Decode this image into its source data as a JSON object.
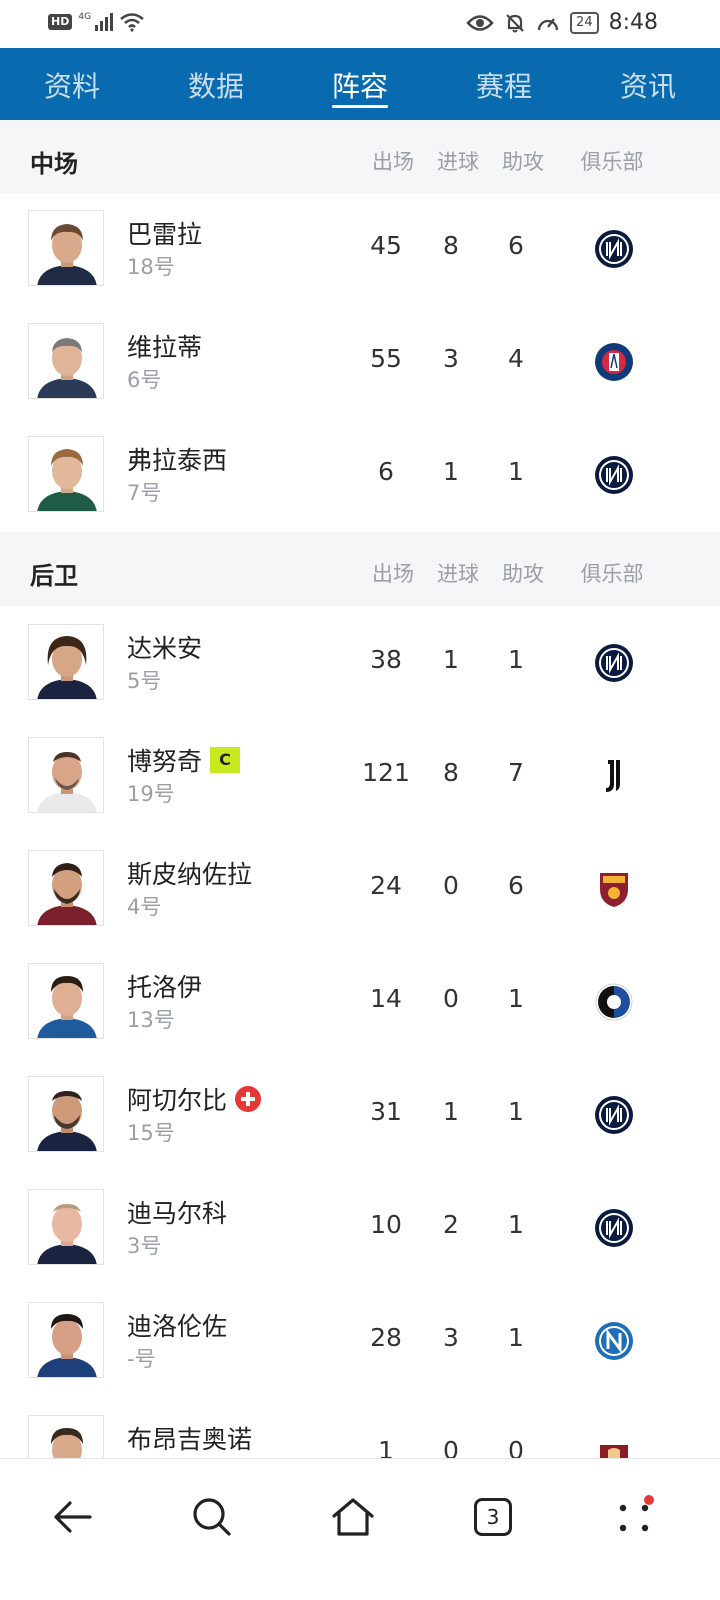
{
  "status_bar": {
    "hd": "HD",
    "network": "4G",
    "battery": "24",
    "time": "8:48"
  },
  "tabs": [
    {
      "label": "资料",
      "active": false
    },
    {
      "label": "数据",
      "active": false
    },
    {
      "label": "阵容",
      "active": true
    },
    {
      "label": "赛程",
      "active": false
    },
    {
      "label": "资讯",
      "active": false
    }
  ],
  "sections": [
    {
      "title": "中场",
      "columns": [
        "出场",
        "进球",
        "助攻",
        "俱乐部"
      ],
      "players": [
        {
          "name": "巴雷拉",
          "number": "18号",
          "apps": "45",
          "goals": "8",
          "assists": "6",
          "club_icon": "inter-logo"
        },
        {
          "name": "维拉蒂",
          "number": "6号",
          "apps": "55",
          "goals": "3",
          "assists": "4",
          "club_icon": "psg-logo"
        },
        {
          "name": "弗拉泰西",
          "number": "7号",
          "apps": "6",
          "goals": "1",
          "assists": "1",
          "club_icon": "inter-logo"
        }
      ]
    },
    {
      "title": "后卫",
      "columns": [
        "出场",
        "进球",
        "助攻",
        "俱乐部"
      ],
      "players": [
        {
          "name": "达米安",
          "number": "5号",
          "apps": "38",
          "goals": "1",
          "assists": "1",
          "club_icon": "inter-logo"
        },
        {
          "name": "博努奇",
          "number": "19号",
          "apps": "121",
          "goals": "8",
          "assists": "7",
          "club_icon": "juventus-logo",
          "badge": "C"
        },
        {
          "name": "斯皮纳佐拉",
          "number": "4号",
          "apps": "24",
          "goals": "0",
          "assists": "6",
          "club_icon": "roma-logo"
        },
        {
          "name": "托洛伊",
          "number": "13号",
          "apps": "14",
          "goals": "0",
          "assists": "1",
          "club_icon": "atalanta-logo"
        },
        {
          "name": "阿切尔比",
          "number": "15号",
          "apps": "31",
          "goals": "1",
          "assists": "1",
          "club_icon": "inter-logo",
          "flag_icon": "swiss-flag-icon"
        },
        {
          "name": "迪马尔科",
          "number": "3号",
          "apps": "10",
          "goals": "2",
          "assists": "1",
          "club_icon": "inter-logo"
        },
        {
          "name": "迪洛伦佐",
          "number": "-号",
          "apps": "28",
          "goals": "3",
          "assists": "1",
          "club_icon": "napoli-logo"
        },
        {
          "name": "布昂吉奥诺",
          "number": "",
          "apps": "1",
          "goals": "0",
          "assists": "0",
          "club_icon": "torino-logo"
        }
      ]
    }
  ],
  "bottom_nav": {
    "tab_count": "3",
    "icons": [
      "back-arrow-icon",
      "search-icon",
      "home-icon",
      "tabs-icon",
      "menu-dots-icon"
    ]
  },
  "colors": {
    "header_blue": "#0a6aaf",
    "captain_badge": "#c6ea1f",
    "flag_red": "#e53935"
  }
}
